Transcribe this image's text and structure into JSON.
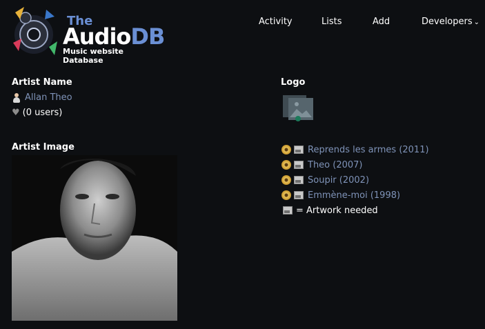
{
  "brand": {
    "the": "The",
    "audio": "Audio",
    "db": "DB",
    "subtitle": "Music website Database"
  },
  "nav": {
    "activity": "Activity",
    "lists": "Lists",
    "add": "Add",
    "developers": "Developers"
  },
  "artist_name_heading": "Artist Name",
  "artist_name": "Allan Theo",
  "users": "(0 users)",
  "logo_heading": "Logo",
  "artist_image_heading": "Artist Image",
  "albums": [
    {
      "title": "Reprends les armes (2011)"
    },
    {
      "title": "Theo (2007)"
    },
    {
      "title": "Soupir (2002)"
    },
    {
      "title": "Emmène-moi (1998)"
    }
  ],
  "legend": "= Artwork needed",
  "colors": {
    "background": "#0d0f12",
    "link": "#7f93b8",
    "brand_blue": "#6a8fd4"
  }
}
